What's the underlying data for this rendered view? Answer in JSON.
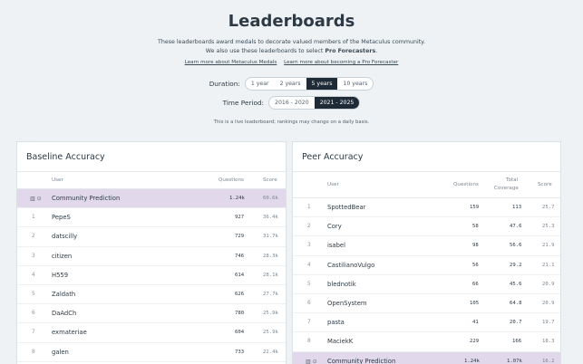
{
  "page": {
    "title": "Leaderboards",
    "desc_line1": "These leaderboards award medals to decorate valued members of the Metaculus community.",
    "desc_line2_pre": "We also use these leaderboards to select ",
    "desc_line2_bold": "Pro Forecasters",
    "desc_line2_post": ".",
    "link_medals": "Learn more about Metaculus Medals",
    "link_pro": "Learn more about becoming a Pro Forecaster",
    "note": "This is a live leaderboard; rankings may change on a daily basis."
  },
  "duration": {
    "label": "Duration:",
    "options": [
      "1 year",
      "2 years",
      "5 years",
      "10 years"
    ],
    "selected": "5 years"
  },
  "period": {
    "label": "Time Period:",
    "options": [
      "2016 - 2020",
      "2021 - 2025"
    ],
    "selected": "2021 - 2025"
  },
  "baseline": {
    "title": "Baseline Accuracy",
    "col_user": "User",
    "col_questions": "Questions",
    "col_score": "Score",
    "community": {
      "icons": "▥ ⊙",
      "user": "Community Prediction",
      "questions": "1.24k",
      "score": "60.6k"
    },
    "rows": [
      {
        "rank": "1",
        "user": "PepeS",
        "questions": "927",
        "score": "36.4k"
      },
      {
        "rank": "2",
        "user": "datscilly",
        "questions": "729",
        "score": "31.7k"
      },
      {
        "rank": "3",
        "user": "citizen",
        "questions": "746",
        "score": "28.3k"
      },
      {
        "rank": "4",
        "user": "H559",
        "questions": "614",
        "score": "28.1k"
      },
      {
        "rank": "5",
        "user": "Zaldath",
        "questions": "626",
        "score": "27.7k"
      },
      {
        "rank": "6",
        "user": "DaAdCh",
        "questions": "780",
        "score": "25.9k"
      },
      {
        "rank": "7",
        "user": "exmateriae",
        "questions": "604",
        "score": "25.9k"
      },
      {
        "rank": "8",
        "user": "galen",
        "questions": "733",
        "score": "22.4k"
      }
    ]
  },
  "peer": {
    "title": "Peer Accuracy",
    "col_user": "User",
    "col_questions": "Questions",
    "col_coverage_1": "Total",
    "col_coverage_2": "Coverage",
    "col_score": "Score",
    "rows": [
      {
        "rank": "1",
        "user": "SpottedBear",
        "questions": "159",
        "coverage": "113",
        "score": "25.7"
      },
      {
        "rank": "2",
        "user": "Cory",
        "questions": "58",
        "coverage": "47.6",
        "score": "25.3"
      },
      {
        "rank": "3",
        "user": "isabel",
        "questions": "98",
        "coverage": "56.6",
        "score": "21.9"
      },
      {
        "rank": "4",
        "user": "CastilianoVulgo",
        "questions": "56",
        "coverage": "29.2",
        "score": "21.1"
      },
      {
        "rank": "5",
        "user": "blednotik",
        "questions": "66",
        "coverage": "45.6",
        "score": "20.9"
      },
      {
        "rank": "6",
        "user": "OpenSystem",
        "questions": "105",
        "coverage": "64.8",
        "score": "20.9"
      },
      {
        "rank": "7",
        "user": "pasta",
        "questions": "41",
        "coverage": "20.7",
        "score": "19.7"
      },
      {
        "rank": "8",
        "user": "MaciekK",
        "questions": "229",
        "coverage": "166",
        "score": "18.3"
      }
    ],
    "community": {
      "icons": "▥ ⊙",
      "user": "Community Prediction",
      "questions": "1.24k",
      "coverage": "1.07k",
      "score": "16.2"
    }
  }
}
